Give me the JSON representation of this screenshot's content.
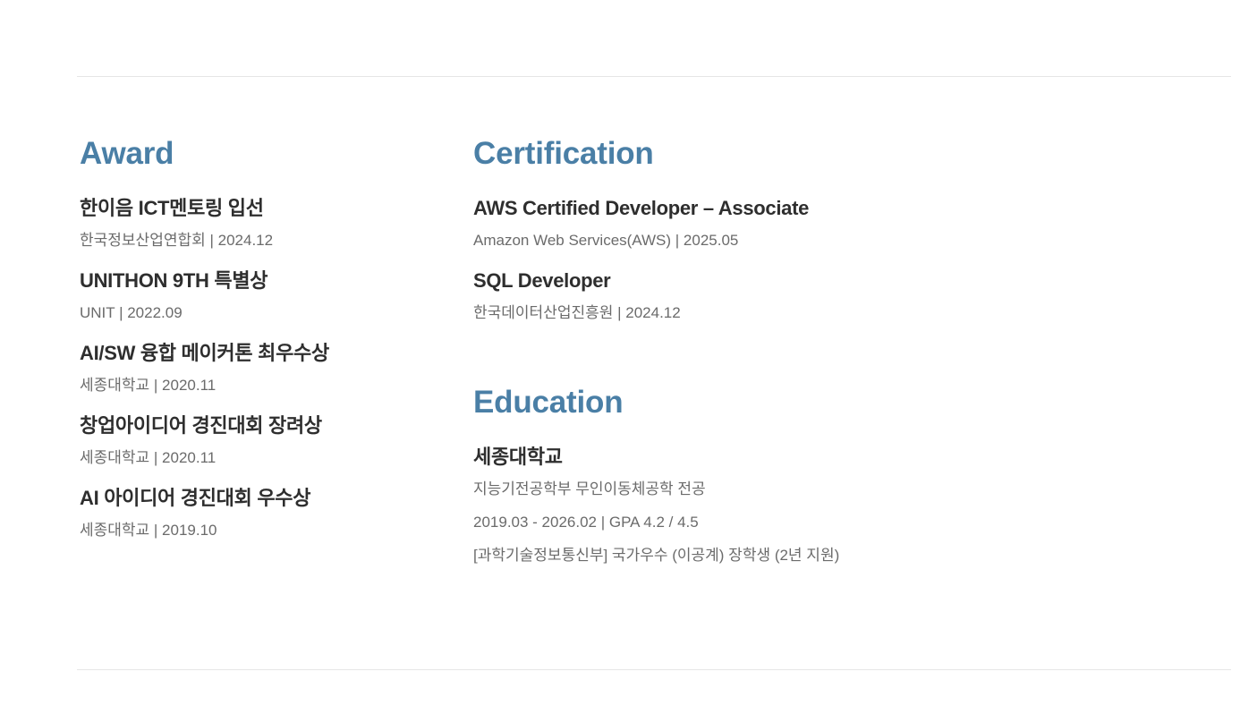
{
  "award": {
    "title": "Award",
    "items": [
      {
        "name": "한이음 ICT멘토링 입선",
        "meta": "한국정보산업연합회 | 2024.12"
      },
      {
        "name": "UNITHON 9TH 특별상",
        "meta": "UNIT | 2022.09"
      },
      {
        "name": "AI/SW 융합 메이커톤 최우수상",
        "meta": "세종대학교 | 2020.11"
      },
      {
        "name": "창업아이디어 경진대회 장려상",
        "meta": "세종대학교 | 2020.11"
      },
      {
        "name": "AI 아이디어 경진대회 우수상",
        "meta": "세종대학교 | 2019.10"
      }
    ]
  },
  "certification": {
    "title": "Certification",
    "items": [
      {
        "name": "AWS Certified Developer – Associate",
        "meta": "Amazon Web Services(AWS) | 2025.05"
      },
      {
        "name": "SQL Developer",
        "meta": "한국데이터산업진흥원 | 2024.12"
      }
    ]
  },
  "education": {
    "title": "Education",
    "school": "세종대학교",
    "major": "지능기전공학부 무인이동체공학 전공",
    "period": "2019.03 - 2026.02 | GPA 4.2 / 4.5",
    "scholarship": "[과학기술정보통신부] 국가우수 (이공계) 장학생 (2년 지원)"
  }
}
